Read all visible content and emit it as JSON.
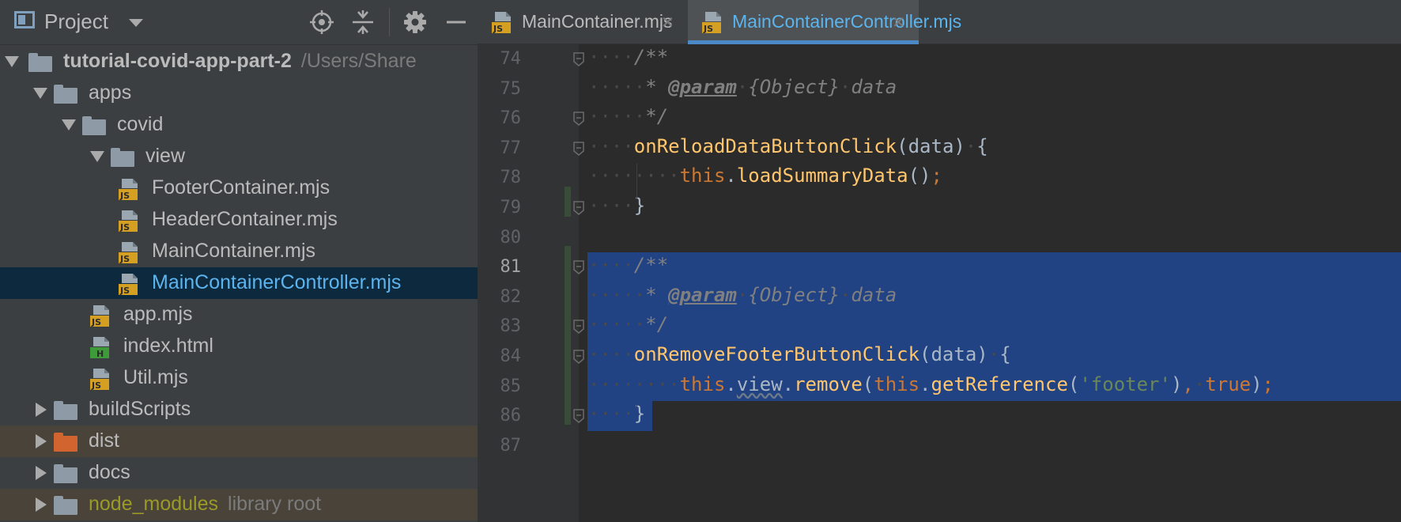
{
  "panel": {
    "title": "Project",
    "icons": [
      "project-icon",
      "dropdown-caret-icon",
      "locate-icon",
      "collapse-all-icon",
      "gear-icon",
      "minimize-icon"
    ]
  },
  "tree": [
    {
      "label": "tutorial-covid-app-part-2",
      "extra": "/Users/Share",
      "depth": 0,
      "expanded": true,
      "type": "folder",
      "bold": true
    },
    {
      "label": "apps",
      "depth": 1,
      "expanded": true,
      "type": "folder"
    },
    {
      "label": "covid",
      "depth": 2,
      "expanded": true,
      "type": "folder"
    },
    {
      "label": "view",
      "depth": 3,
      "expanded": true,
      "type": "folder"
    },
    {
      "label": "FooterContainer.mjs",
      "depth": 4,
      "type": "js"
    },
    {
      "label": "HeaderContainer.mjs",
      "depth": 4,
      "type": "js"
    },
    {
      "label": "MainContainer.mjs",
      "depth": 4,
      "type": "js"
    },
    {
      "label": "MainContainerController.mjs",
      "depth": 4,
      "type": "js",
      "selected": true
    },
    {
      "label": "app.mjs",
      "depth": 3,
      "type": "js"
    },
    {
      "label": "index.html",
      "depth": 3,
      "type": "html"
    },
    {
      "label": "Util.mjs",
      "depth": 3,
      "type": "js"
    },
    {
      "label": "buildScripts",
      "depth": 1,
      "expanded": false,
      "type": "folder"
    },
    {
      "label": "dist",
      "depth": 1,
      "expanded": false,
      "type": "folder",
      "excluded": true,
      "orange": true
    },
    {
      "label": "docs",
      "depth": 1,
      "expanded": false,
      "type": "folder"
    },
    {
      "label": "node_modules",
      "extra": "library root",
      "depth": 1,
      "expanded": false,
      "type": "folder",
      "excluded": true,
      "library": true
    }
  ],
  "tabs": [
    {
      "label": "MainContainer.mjs",
      "active": false
    },
    {
      "label": "MainContainerController.mjs",
      "active": true
    }
  ],
  "editor": {
    "current_line": 81,
    "lines": [
      {
        "num": 74,
        "segments": [
          [
            "dots",
            "····"
          ],
          [
            "comment",
            "/**"
          ]
        ]
      },
      {
        "num": 75,
        "segments": [
          [
            "dots",
            "·····"
          ],
          [
            "comment",
            "* "
          ],
          [
            "tag",
            "@param"
          ],
          [
            "dots",
            "·"
          ],
          [
            "comment",
            "{Object}"
          ],
          [
            "dots",
            "·"
          ],
          [
            "comment",
            "data"
          ]
        ]
      },
      {
        "num": 76,
        "segments": [
          [
            "dots",
            "·····"
          ],
          [
            "comment",
            "*/"
          ]
        ]
      },
      {
        "num": 77,
        "segments": [
          [
            "dots",
            "····"
          ],
          [
            "fn",
            "onReloadDataButtonClick"
          ],
          [
            "plain",
            "(data)"
          ],
          [
            "dots",
            "·"
          ],
          [
            "plain",
            "{"
          ]
        ]
      },
      {
        "num": 78,
        "segments": [
          [
            "dots",
            "········"
          ],
          [
            "kw",
            "this"
          ],
          [
            "plain",
            "."
          ],
          [
            "fn",
            "loadSummaryData"
          ],
          [
            "plain",
            "()"
          ],
          [
            "kw",
            ";"
          ]
        ]
      },
      {
        "num": 79,
        "segments": [
          [
            "dots",
            "····"
          ],
          [
            "plain",
            "}"
          ]
        ]
      },
      {
        "num": 80,
        "segments": []
      },
      {
        "num": 81,
        "segments": [
          [
            "dots",
            "····"
          ],
          [
            "comment",
            "/**"
          ]
        ]
      },
      {
        "num": 82,
        "segments": [
          [
            "dots",
            "·····"
          ],
          [
            "comment",
            "* "
          ],
          [
            "tag",
            "@param"
          ],
          [
            "dots",
            "·"
          ],
          [
            "comment",
            "{Object}"
          ],
          [
            "dots",
            "·"
          ],
          [
            "comment",
            "data"
          ]
        ]
      },
      {
        "num": 83,
        "segments": [
          [
            "dots",
            "·····"
          ],
          [
            "comment",
            "*/"
          ]
        ]
      },
      {
        "num": 84,
        "segments": [
          [
            "dots",
            "····"
          ],
          [
            "fn",
            "onRemoveFooterButtonClick"
          ],
          [
            "plain",
            "(data)"
          ],
          [
            "dots",
            "·"
          ],
          [
            "plain",
            "{"
          ]
        ]
      },
      {
        "num": 85,
        "segments": [
          [
            "dots",
            "········"
          ],
          [
            "kw",
            "this"
          ],
          [
            "plain",
            "."
          ],
          [
            "squiggle",
            "view"
          ],
          [
            "plain",
            "."
          ],
          [
            "fn",
            "remove"
          ],
          [
            "plain",
            "("
          ],
          [
            "kw",
            "this"
          ],
          [
            "plain",
            "."
          ],
          [
            "fn",
            "getReference"
          ],
          [
            "plain",
            "("
          ],
          [
            "str",
            "'footer'"
          ],
          [
            "plain",
            ")"
          ],
          [
            "kw",
            ","
          ],
          [
            "dots",
            "·"
          ],
          [
            "kw",
            "true"
          ],
          [
            "plain",
            ")"
          ],
          [
            "kw",
            ";"
          ]
        ]
      },
      {
        "num": 86,
        "segments": [
          [
            "dots",
            "····"
          ],
          [
            "plain",
            "}"
          ]
        ]
      },
      {
        "num": 87,
        "segments": []
      }
    ]
  }
}
